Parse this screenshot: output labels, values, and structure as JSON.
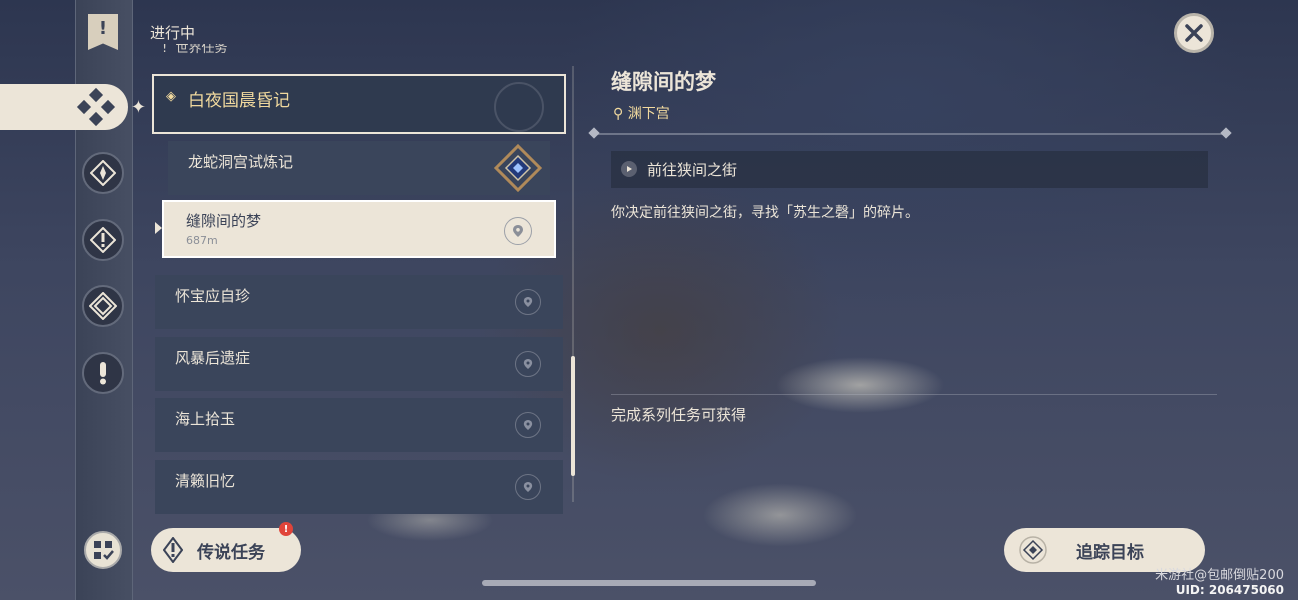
{
  "section_label": "进行中",
  "cut_header": "世界任务",
  "quest_group": {
    "title": "白夜国晨昏记"
  },
  "quest_sub": {
    "title": "龙蛇洞宫试炼记"
  },
  "selected_quest": {
    "title": "缝隙间的梦",
    "distance": "687m"
  },
  "quests": [
    {
      "title": "怀宝应自珍"
    },
    {
      "title": "风暴后遗症"
    },
    {
      "title": "海上拾玉"
    },
    {
      "title": "清籁旧忆"
    }
  ],
  "legend_button": {
    "label": "传说任务",
    "badge": "!"
  },
  "detail": {
    "title": "缝隙间的梦",
    "location": "渊下宫",
    "step": "前往狭间之街",
    "description": "你决定前往狭间之街，寻找「苏生之磬」的碎片。",
    "reward_label": "完成系列任务可获得"
  },
  "track_button": {
    "label": "追踪目标"
  },
  "watermark": {
    "text": "米游社@包邮倒贴200",
    "uid": "UID: 206475060"
  },
  "icons": [
    "quest-banner-icon",
    "all-quests-icon",
    "archon-quest-icon",
    "story-quest-icon",
    "world-quest-icon",
    "daily-quest-icon",
    "close-icon",
    "location-pin-icon",
    "navigate-icon",
    "track-icon",
    "commission-icon"
  ],
  "colors": {
    "cream": "#ece5d8",
    "gold": "#f1d99e",
    "panel": "#3a455b",
    "alert": "#e0443a"
  }
}
